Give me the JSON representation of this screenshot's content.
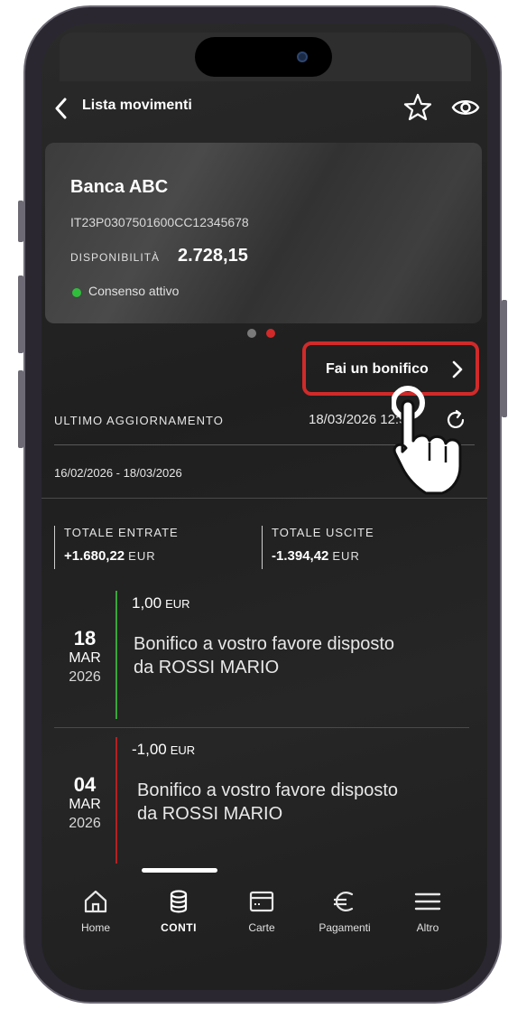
{
  "header": {
    "title": "Lista movimenti"
  },
  "icons": {
    "back": "chevron-left-icon",
    "favorite": "star-icon",
    "visibility": "eye-icon",
    "refresh": "refresh-icon"
  },
  "card": {
    "bank_name": "Banca ABC",
    "iban": "IT23P0307501600CC12345678",
    "disponibilita_label": "DISPONIBILITÀ",
    "disponibilita_value": "2.728,15",
    "consent_label": "Consenso attivo"
  },
  "pager": {
    "active_index": 1,
    "count": 2
  },
  "bonifico": {
    "label": "Fai un bonifico"
  },
  "update": {
    "label": "ULTIMO AGGIORNAMENTO",
    "value": "18/03/2026 12:50"
  },
  "range": {
    "label": "16/02/2026 - 18/03/2026"
  },
  "totals": {
    "entrate": {
      "label": "TOTALE ENTRATE",
      "value": "+1.680,22",
      "currency": "EUR"
    },
    "uscite": {
      "label": "TOTALE USCITE",
      "value": "-1.394,42",
      "currency": "EUR"
    }
  },
  "transactions": [
    {
      "day": "18",
      "month": "MAR",
      "year": "2026",
      "amount": "1,00",
      "currency": "EUR",
      "description": "Bonifico a vostro favore disposto da ROSSI MARIO",
      "type": "credit"
    },
    {
      "day": "04",
      "month": "MAR",
      "year": "2026",
      "amount": "-1,00",
      "currency": "EUR",
      "description": "Bonifico a vostro favore disposto da ROSSI MARIO",
      "type": "debit"
    }
  ],
  "tabs": [
    {
      "label": "Home",
      "icon": "home-icon",
      "active": false
    },
    {
      "label": "CONTI",
      "icon": "database-icon",
      "active": true
    },
    {
      "label": "Carte",
      "icon": "card-icon",
      "active": false
    },
    {
      "label": "Pagamenti",
      "icon": "euro-icon",
      "active": false
    },
    {
      "label": "Altro",
      "icon": "menu-icon",
      "active": false
    }
  ],
  "colors": {
    "accent_red": "#d12a2a",
    "credit_green": "#3ba53b",
    "debit_red": "#b52020",
    "consent_green": "#2fbf3b",
    "background": "#232323"
  }
}
